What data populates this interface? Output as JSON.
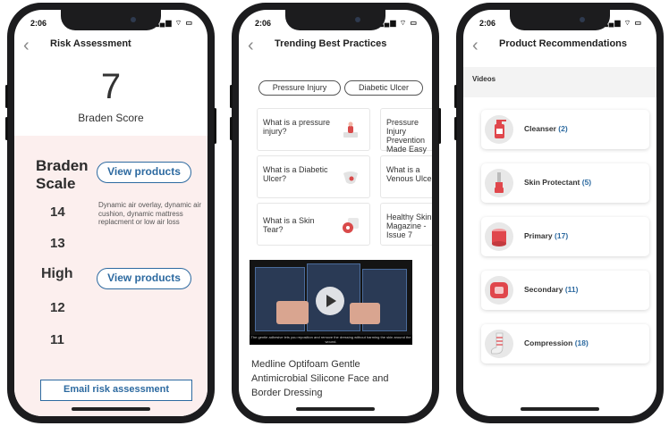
{
  "status": {
    "time": "2:06",
    "icons": "▂▄▆ ⌔ ▭"
  },
  "phone1": {
    "title": "Risk Assessment",
    "score": "7",
    "score_label": "Braden Score",
    "scale_title_line1": "Braden",
    "scale_title_line2": "Scale",
    "view_products": "View products",
    "rows": [
      "14",
      "13",
      "High",
      "12",
      "11"
    ],
    "description": "Dynamic air overlay, dynamic air cushion, dynamic mattress replacment or low air loss",
    "email_button": "Email risk assessment",
    "panel_color": "#fcefee",
    "accent": "#2d6aa0"
  },
  "phone2": {
    "title": "Trending Best Practices",
    "tabs": [
      "Pressure Injury",
      "Diabetic Ulcer"
    ],
    "cards": [
      {
        "text": "What is a pressure injury?",
        "icon": "pressure-injury-icon"
      },
      {
        "text": "Pressure Injury Prevention Made Easy",
        "icon": ""
      },
      {
        "text": "What is a Diabetic Ulcer?",
        "icon": "diabetic-foot-icon"
      },
      {
        "text": "What is a Venous Ulcer",
        "icon": ""
      },
      {
        "text": "What is a Skin Tear?",
        "icon": "skin-tear-icon"
      },
      {
        "text": "Healthy Skin Magazine - Issue 7",
        "icon": ""
      }
    ],
    "video_title": "Medline Optifoam Gentle Antimicrobial Silicone Face and Border Dressing",
    "video_caption": "The gentle adhesive lets you reposition and remove the dressing without harming the skin around the wound."
  },
  "phone3": {
    "title": "Product Recommendations",
    "videos_label": "Videos",
    "categories": [
      {
        "name": "Cleanser",
        "count": "(2)",
        "icon": "cleanser-bottle-icon"
      },
      {
        "name": "Skin Protectant",
        "count": "(5)",
        "icon": "skin-protectant-icon"
      },
      {
        "name": "Primary",
        "count": "(17)",
        "icon": "primary-dressing-icon"
      },
      {
        "name": "Secondary",
        "count": "(11)",
        "icon": "secondary-dressing-icon"
      },
      {
        "name": "Compression",
        "count": "(18)",
        "icon": "compression-stocking-icon"
      }
    ]
  }
}
